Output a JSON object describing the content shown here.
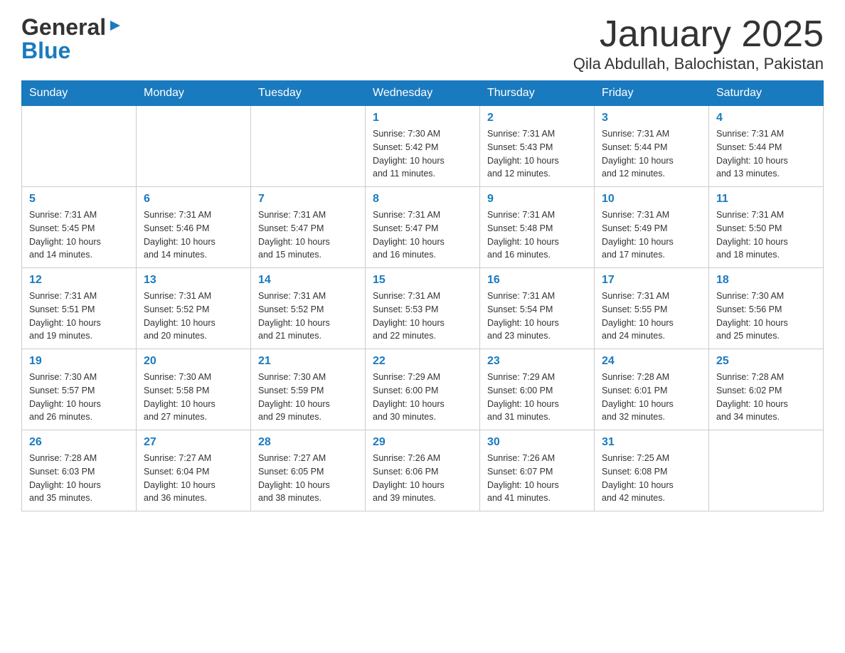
{
  "header": {
    "logo_general": "General",
    "logo_arrow": "▶",
    "logo_blue": "Blue",
    "month_title": "January 2025",
    "location": "Qila Abdullah, Balochistan, Pakistan"
  },
  "days_of_week": [
    "Sunday",
    "Monday",
    "Tuesday",
    "Wednesday",
    "Thursday",
    "Friday",
    "Saturday"
  ],
  "weeks": [
    [
      {
        "day": "",
        "info": ""
      },
      {
        "day": "",
        "info": ""
      },
      {
        "day": "",
        "info": ""
      },
      {
        "day": "1",
        "info": "Sunrise: 7:30 AM\nSunset: 5:42 PM\nDaylight: 10 hours\nand 11 minutes."
      },
      {
        "day": "2",
        "info": "Sunrise: 7:31 AM\nSunset: 5:43 PM\nDaylight: 10 hours\nand 12 minutes."
      },
      {
        "day": "3",
        "info": "Sunrise: 7:31 AM\nSunset: 5:44 PM\nDaylight: 10 hours\nand 12 minutes."
      },
      {
        "day": "4",
        "info": "Sunrise: 7:31 AM\nSunset: 5:44 PM\nDaylight: 10 hours\nand 13 minutes."
      }
    ],
    [
      {
        "day": "5",
        "info": "Sunrise: 7:31 AM\nSunset: 5:45 PM\nDaylight: 10 hours\nand 14 minutes."
      },
      {
        "day": "6",
        "info": "Sunrise: 7:31 AM\nSunset: 5:46 PM\nDaylight: 10 hours\nand 14 minutes."
      },
      {
        "day": "7",
        "info": "Sunrise: 7:31 AM\nSunset: 5:47 PM\nDaylight: 10 hours\nand 15 minutes."
      },
      {
        "day": "8",
        "info": "Sunrise: 7:31 AM\nSunset: 5:47 PM\nDaylight: 10 hours\nand 16 minutes."
      },
      {
        "day": "9",
        "info": "Sunrise: 7:31 AM\nSunset: 5:48 PM\nDaylight: 10 hours\nand 16 minutes."
      },
      {
        "day": "10",
        "info": "Sunrise: 7:31 AM\nSunset: 5:49 PM\nDaylight: 10 hours\nand 17 minutes."
      },
      {
        "day": "11",
        "info": "Sunrise: 7:31 AM\nSunset: 5:50 PM\nDaylight: 10 hours\nand 18 minutes."
      }
    ],
    [
      {
        "day": "12",
        "info": "Sunrise: 7:31 AM\nSunset: 5:51 PM\nDaylight: 10 hours\nand 19 minutes."
      },
      {
        "day": "13",
        "info": "Sunrise: 7:31 AM\nSunset: 5:52 PM\nDaylight: 10 hours\nand 20 minutes."
      },
      {
        "day": "14",
        "info": "Sunrise: 7:31 AM\nSunset: 5:52 PM\nDaylight: 10 hours\nand 21 minutes."
      },
      {
        "day": "15",
        "info": "Sunrise: 7:31 AM\nSunset: 5:53 PM\nDaylight: 10 hours\nand 22 minutes."
      },
      {
        "day": "16",
        "info": "Sunrise: 7:31 AM\nSunset: 5:54 PM\nDaylight: 10 hours\nand 23 minutes."
      },
      {
        "day": "17",
        "info": "Sunrise: 7:31 AM\nSunset: 5:55 PM\nDaylight: 10 hours\nand 24 minutes."
      },
      {
        "day": "18",
        "info": "Sunrise: 7:30 AM\nSunset: 5:56 PM\nDaylight: 10 hours\nand 25 minutes."
      }
    ],
    [
      {
        "day": "19",
        "info": "Sunrise: 7:30 AM\nSunset: 5:57 PM\nDaylight: 10 hours\nand 26 minutes."
      },
      {
        "day": "20",
        "info": "Sunrise: 7:30 AM\nSunset: 5:58 PM\nDaylight: 10 hours\nand 27 minutes."
      },
      {
        "day": "21",
        "info": "Sunrise: 7:30 AM\nSunset: 5:59 PM\nDaylight: 10 hours\nand 29 minutes."
      },
      {
        "day": "22",
        "info": "Sunrise: 7:29 AM\nSunset: 6:00 PM\nDaylight: 10 hours\nand 30 minutes."
      },
      {
        "day": "23",
        "info": "Sunrise: 7:29 AM\nSunset: 6:00 PM\nDaylight: 10 hours\nand 31 minutes."
      },
      {
        "day": "24",
        "info": "Sunrise: 7:28 AM\nSunset: 6:01 PM\nDaylight: 10 hours\nand 32 minutes."
      },
      {
        "day": "25",
        "info": "Sunrise: 7:28 AM\nSunset: 6:02 PM\nDaylight: 10 hours\nand 34 minutes."
      }
    ],
    [
      {
        "day": "26",
        "info": "Sunrise: 7:28 AM\nSunset: 6:03 PM\nDaylight: 10 hours\nand 35 minutes."
      },
      {
        "day": "27",
        "info": "Sunrise: 7:27 AM\nSunset: 6:04 PM\nDaylight: 10 hours\nand 36 minutes."
      },
      {
        "day": "28",
        "info": "Sunrise: 7:27 AM\nSunset: 6:05 PM\nDaylight: 10 hours\nand 38 minutes."
      },
      {
        "day": "29",
        "info": "Sunrise: 7:26 AM\nSunset: 6:06 PM\nDaylight: 10 hours\nand 39 minutes."
      },
      {
        "day": "30",
        "info": "Sunrise: 7:26 AM\nSunset: 6:07 PM\nDaylight: 10 hours\nand 41 minutes."
      },
      {
        "day": "31",
        "info": "Sunrise: 7:25 AM\nSunset: 6:08 PM\nDaylight: 10 hours\nand 42 minutes."
      },
      {
        "day": "",
        "info": ""
      }
    ]
  ]
}
